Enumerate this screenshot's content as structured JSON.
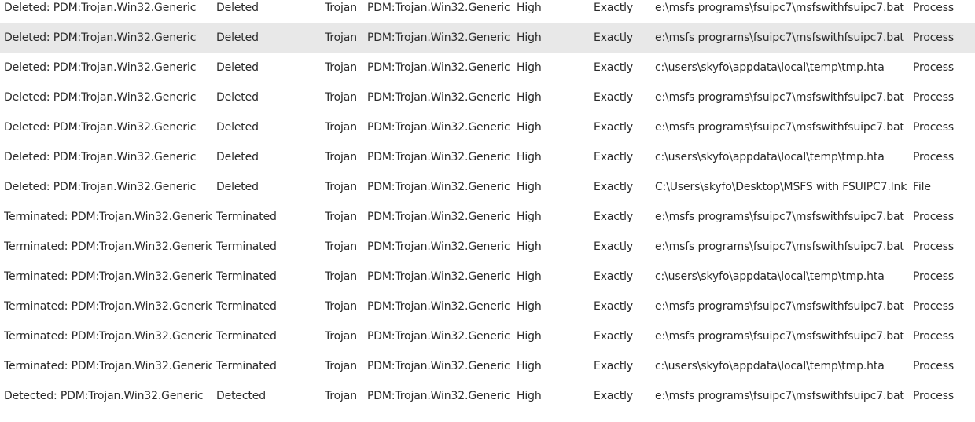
{
  "rows": [
    {
      "event": "Deleted: PDM:Trojan.Win32.Generic",
      "action": "Deleted",
      "type": "Trojan",
      "name": "PDM:Trojan.Win32.Generic",
      "severity": "High",
      "match": "Exactly",
      "path": "e:\\msfs programs\\fsuipc7\\msfswithfsuipc7.bat",
      "object": "Process",
      "selected": false
    },
    {
      "event": "Deleted: PDM:Trojan.Win32.Generic",
      "action": "Deleted",
      "type": "Trojan",
      "name": "PDM:Trojan.Win32.Generic",
      "severity": "High",
      "match": "Exactly",
      "path": "e:\\msfs programs\\fsuipc7\\msfswithfsuipc7.bat",
      "object": "Process",
      "selected": true
    },
    {
      "event": "Deleted: PDM:Trojan.Win32.Generic",
      "action": "Deleted",
      "type": "Trojan",
      "name": "PDM:Trojan.Win32.Generic",
      "severity": "High",
      "match": "Exactly",
      "path": "c:\\users\\skyfo\\appdata\\local\\temp\\tmp.hta",
      "object": "Process",
      "selected": false
    },
    {
      "event": "Deleted: PDM:Trojan.Win32.Generic",
      "action": "Deleted",
      "type": "Trojan",
      "name": "PDM:Trojan.Win32.Generic",
      "severity": "High",
      "match": "Exactly",
      "path": "e:\\msfs programs\\fsuipc7\\msfswithfsuipc7.bat",
      "object": "Process",
      "selected": false
    },
    {
      "event": "Deleted: PDM:Trojan.Win32.Generic",
      "action": "Deleted",
      "type": "Trojan",
      "name": "PDM:Trojan.Win32.Generic",
      "severity": "High",
      "match": "Exactly",
      "path": "e:\\msfs programs\\fsuipc7\\msfswithfsuipc7.bat",
      "object": "Process",
      "selected": false
    },
    {
      "event": "Deleted: PDM:Trojan.Win32.Generic",
      "action": "Deleted",
      "type": "Trojan",
      "name": "PDM:Trojan.Win32.Generic",
      "severity": "High",
      "match": "Exactly",
      "path": "c:\\users\\skyfo\\appdata\\local\\temp\\tmp.hta",
      "object": "Process",
      "selected": false
    },
    {
      "event": "Deleted: PDM:Trojan.Win32.Generic",
      "action": "Deleted",
      "type": "Trojan",
      "name": "PDM:Trojan.Win32.Generic",
      "severity": "High",
      "match": "Exactly",
      "path": "C:\\Users\\skyfo\\Desktop\\MSFS with FSUIPC7.lnk",
      "object": "File",
      "selected": false
    },
    {
      "event": "Terminated: PDM:Trojan.Win32.Generic",
      "action": "Terminated",
      "type": "Trojan",
      "name": "PDM:Trojan.Win32.Generic",
      "severity": "High",
      "match": "Exactly",
      "path": "e:\\msfs programs\\fsuipc7\\msfswithfsuipc7.bat",
      "object": "Process",
      "selected": false
    },
    {
      "event": "Terminated: PDM:Trojan.Win32.Generic",
      "action": "Terminated",
      "type": "Trojan",
      "name": "PDM:Trojan.Win32.Generic",
      "severity": "High",
      "match": "Exactly",
      "path": "e:\\msfs programs\\fsuipc7\\msfswithfsuipc7.bat",
      "object": "Process",
      "selected": false
    },
    {
      "event": "Terminated: PDM:Trojan.Win32.Generic",
      "action": "Terminated",
      "type": "Trojan",
      "name": "PDM:Trojan.Win32.Generic",
      "severity": "High",
      "match": "Exactly",
      "path": "c:\\users\\skyfo\\appdata\\local\\temp\\tmp.hta",
      "object": "Process",
      "selected": false
    },
    {
      "event": "Terminated: PDM:Trojan.Win32.Generic",
      "action": "Terminated",
      "type": "Trojan",
      "name": "PDM:Trojan.Win32.Generic",
      "severity": "High",
      "match": "Exactly",
      "path": "e:\\msfs programs\\fsuipc7\\msfswithfsuipc7.bat",
      "object": "Process",
      "selected": false
    },
    {
      "event": "Terminated: PDM:Trojan.Win32.Generic",
      "action": "Terminated",
      "type": "Trojan",
      "name": "PDM:Trojan.Win32.Generic",
      "severity": "High",
      "match": "Exactly",
      "path": "e:\\msfs programs\\fsuipc7\\msfswithfsuipc7.bat",
      "object": "Process",
      "selected": false
    },
    {
      "event": "Terminated: PDM:Trojan.Win32.Generic",
      "action": "Terminated",
      "type": "Trojan",
      "name": "PDM:Trojan.Win32.Generic",
      "severity": "High",
      "match": "Exactly",
      "path": "c:\\users\\skyfo\\appdata\\local\\temp\\tmp.hta",
      "object": "Process",
      "selected": false
    },
    {
      "event": "Detected: PDM:Trojan.Win32.Generic",
      "action": "Detected",
      "type": "Trojan",
      "name": "PDM:Trojan.Win32.Generic",
      "severity": "High",
      "match": "Exactly",
      "path": "e:\\msfs programs\\fsuipc7\\msfswithfsuipc7.bat",
      "object": "Process",
      "selected": false
    }
  ],
  "colors": {
    "text": "#2b2b2b",
    "selected_row": "#e8e8e8",
    "background": "#ffffff"
  }
}
